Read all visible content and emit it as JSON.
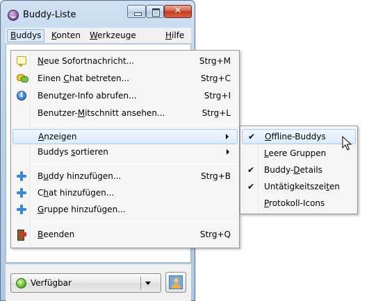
{
  "window": {
    "title": "Buddy-Liste",
    "close_symbol": "✕"
  },
  "menubar": {
    "items": [
      {
        "label": "Buddys",
        "mnemonic_index": 0,
        "active": true
      },
      {
        "label": "Konten",
        "mnemonic_index": 0,
        "active": false
      },
      {
        "label": "Werkzeuge",
        "mnemonic_index": 0,
        "active": false
      },
      {
        "label": "Hilfe",
        "mnemonic_index": 0,
        "active": false
      }
    ]
  },
  "buddys_menu": {
    "items": [
      {
        "icon": "new-message-icon",
        "label_pre": "",
        "label_u": "N",
        "label_post": "eue Sofortnachricht...",
        "shortcut": "Strg+M"
      },
      {
        "icon": "chat-icon",
        "label_pre": "Einen ",
        "label_u": "C",
        "label_post": "hat betreten...",
        "shortcut": "Strg+C"
      },
      {
        "icon": "info-icon",
        "label_pre": "Benut",
        "label_u": "z",
        "label_post": "er-Info abrufen...",
        "shortcut": "Strg+I"
      },
      {
        "icon": "",
        "label_pre": "Benutzer-",
        "label_u": "M",
        "label_post": "itschnitt ansehen...",
        "shortcut": "Strg+L"
      },
      {
        "icon": "",
        "label_pre": "",
        "label_u": "A",
        "label_post": "nzeigen",
        "shortcut": "",
        "submenu": true,
        "highlighted": true
      },
      {
        "icon": "",
        "label_pre": "Buddys ",
        "label_u": "s",
        "label_post": "ortieren",
        "shortcut": "",
        "submenu": true
      },
      {
        "icon": "add-buddy-icon",
        "label_pre": "B",
        "label_u": "u",
        "label_post": "ddy hinzufügen...",
        "shortcut": "Strg+B"
      },
      {
        "icon": "add-chat-icon",
        "label_pre": "C",
        "label_u": "h",
        "label_post": "at hinzufügen...",
        "shortcut": ""
      },
      {
        "icon": "add-group-icon",
        "label_pre": "",
        "label_u": "G",
        "label_post": "ruppe hinzufügen...",
        "shortcut": ""
      },
      {
        "icon": "quit-icon",
        "label_pre": "",
        "label_u": "B",
        "label_post": "eenden",
        "shortcut": "Strg+Q"
      }
    ]
  },
  "anzeigen_submenu": {
    "items": [
      {
        "checked": true,
        "label_pre": "",
        "label_u": "O",
        "label_post": "ffline-Buddys",
        "highlighted": true
      },
      {
        "checked": false,
        "label_pre": "",
        "label_u": "L",
        "label_post": "eere Gruppen"
      },
      {
        "checked": true,
        "label_pre": "Buddy-",
        "label_u": "D",
        "label_post": "etails"
      },
      {
        "checked": true,
        "label_pre": "Untätigkeitszei",
        "label_u": "t",
        "label_post": "en"
      },
      {
        "checked": false,
        "label_pre": "",
        "label_u": "P",
        "label_post": "rotokoll-Icons"
      }
    ],
    "check_symbol": "✔"
  },
  "status": {
    "label": "Verfügbar",
    "color": "#5fbc2a"
  }
}
